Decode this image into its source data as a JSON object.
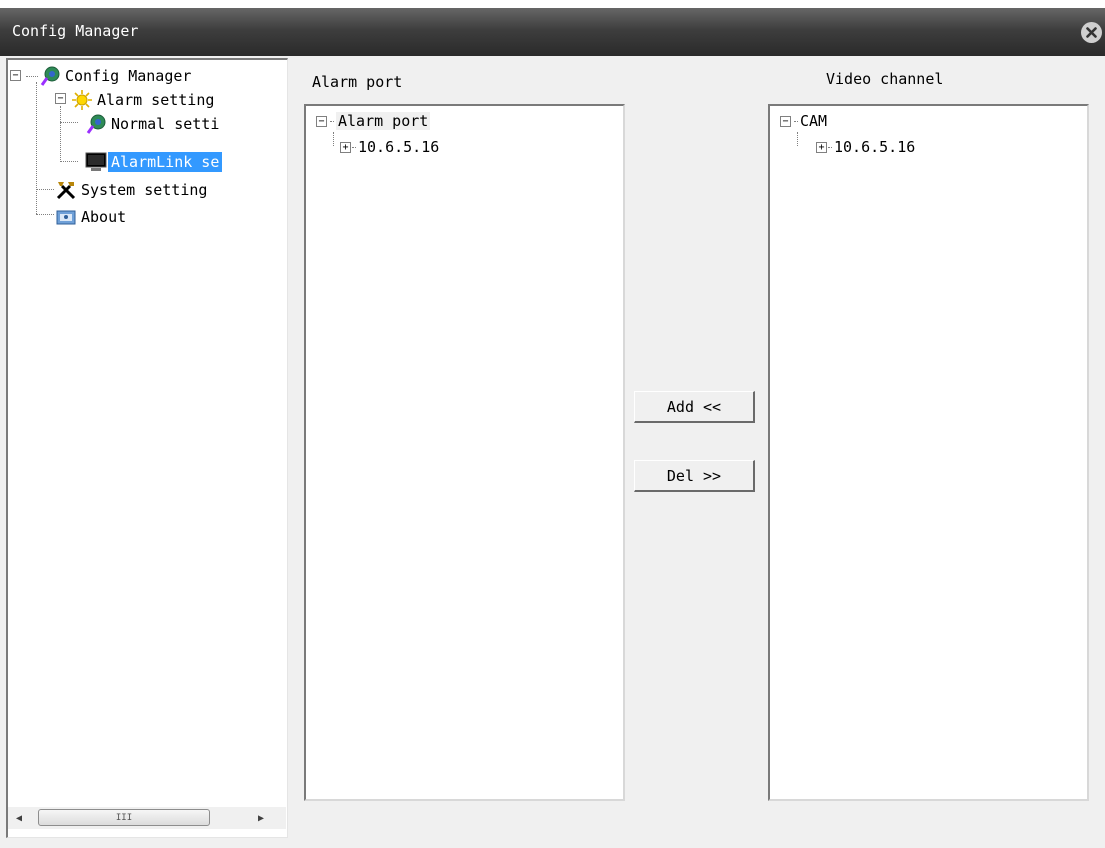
{
  "window": {
    "title": "Config Manager"
  },
  "tree": {
    "root": "Config Manager",
    "alarm_setting": "Alarm setting",
    "normal_setting": "Normal setti",
    "alarmlink_setting": "AlarmLink se",
    "system_setting": "System setting",
    "about": "About"
  },
  "alarm_port": {
    "label": "Alarm port",
    "root": "Alarm port",
    "items": [
      "10.6.5.16"
    ]
  },
  "video_channel": {
    "label": "Video channel",
    "root": "CAM",
    "items": [
      "10.6.5.16"
    ]
  },
  "buttons": {
    "add": "Add <<",
    "del": "Del >>"
  },
  "scrollbar": {
    "grip": "III"
  },
  "colors": {
    "selection": "#3399ff",
    "titlebar": "#3a3a3a"
  }
}
